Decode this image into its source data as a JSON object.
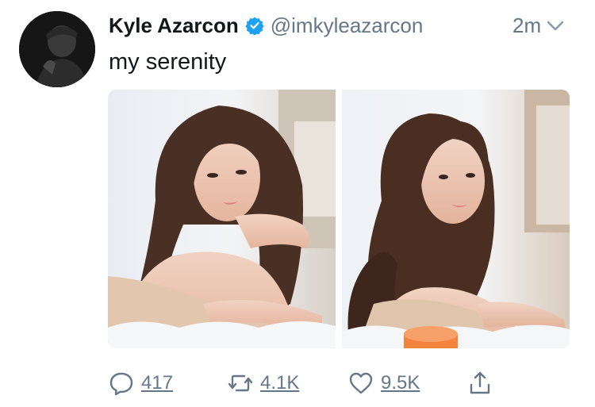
{
  "tweet": {
    "display_name": "Kyle Azarcon",
    "handle": "@imkyleazarcon",
    "time": "2m",
    "text": "my serenity",
    "verified": true
  },
  "media": {
    "count": 2,
    "images": [
      "photo-left",
      "photo-right"
    ]
  },
  "actions": {
    "reply": {
      "icon": "reply-icon",
      "count": "417"
    },
    "retweet": {
      "icon": "retweet-icon",
      "count": "4.1K"
    },
    "like": {
      "icon": "heart-icon",
      "count": "9.5K"
    },
    "share": {
      "icon": "share-icon"
    }
  },
  "colors": {
    "text": "#14171a",
    "secondary": "#657786",
    "verified": "#1da1f2"
  }
}
